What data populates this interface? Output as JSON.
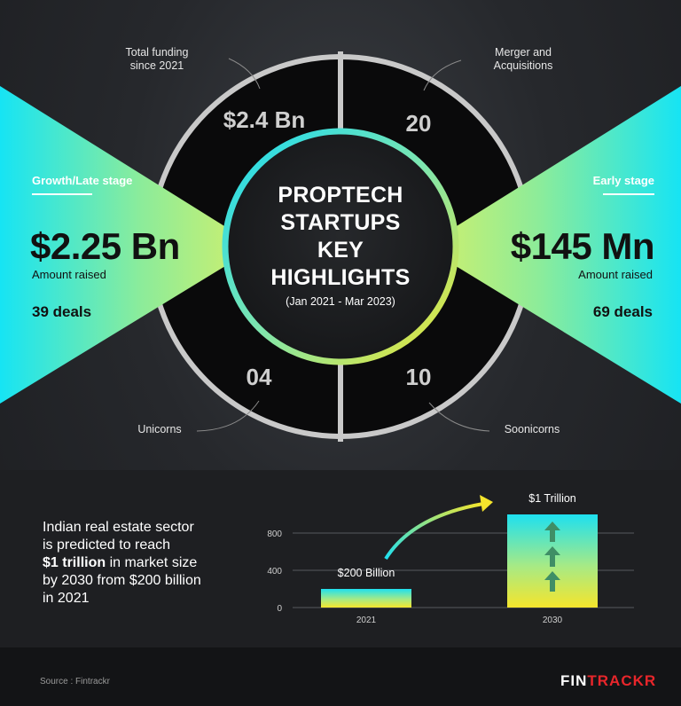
{
  "center": {
    "title_lines": [
      "PROPTECH",
      "STARTUPS",
      "KEY",
      "HIGHLIGHTS"
    ],
    "period": "(Jan 2021 - Mar 2023)"
  },
  "quadrants": {
    "top_left": {
      "label_line1": "Total funding",
      "label_line2": "since 2021",
      "value": "$2.4 Bn"
    },
    "top_right": {
      "label_line1": "Merger and",
      "label_line2": "Acquisitions",
      "value": "20"
    },
    "bottom_left": {
      "label": "Unicorns",
      "value": "04"
    },
    "bottom_right": {
      "label": "Soonicorns",
      "value": "10"
    }
  },
  "growth_stage": {
    "label": "Growth/Late stage",
    "amount": "$2.25 Bn",
    "amount_caption": "Amount raised",
    "deals": "39 deals"
  },
  "early_stage": {
    "label": "Early stage",
    "amount": "$145 Mn",
    "amount_caption": "Amount raised",
    "deals": "69 deals"
  },
  "market_note": {
    "part1": "Indian real estate sector",
    "part2": "is predicted to reach",
    "bold": "$1 trillion",
    "part3": " in market size",
    "part4": "by 2030 from $200 billion",
    "part5": "in 2021"
  },
  "chart_data": {
    "type": "bar",
    "categories": [
      "2021",
      "2030"
    ],
    "values": [
      200,
      1000
    ],
    "data_labels": [
      "$200 Billion",
      "$1 Trillion"
    ],
    "yticks": [
      "0",
      "400",
      "800"
    ],
    "ylim": [
      0,
      1000
    ],
    "grid": true,
    "title": "",
    "xlabel": "",
    "ylabel": ""
  },
  "footer": {
    "source": "Source : Fintrackr",
    "logo_part1": "FIN",
    "logo_part2": "TRACKR"
  },
  "colors": {
    "cyan": "#1ee0f0",
    "lime": "#c8ee6a",
    "yellow": "#f5e52c",
    "accent_red": "#e8262b"
  }
}
